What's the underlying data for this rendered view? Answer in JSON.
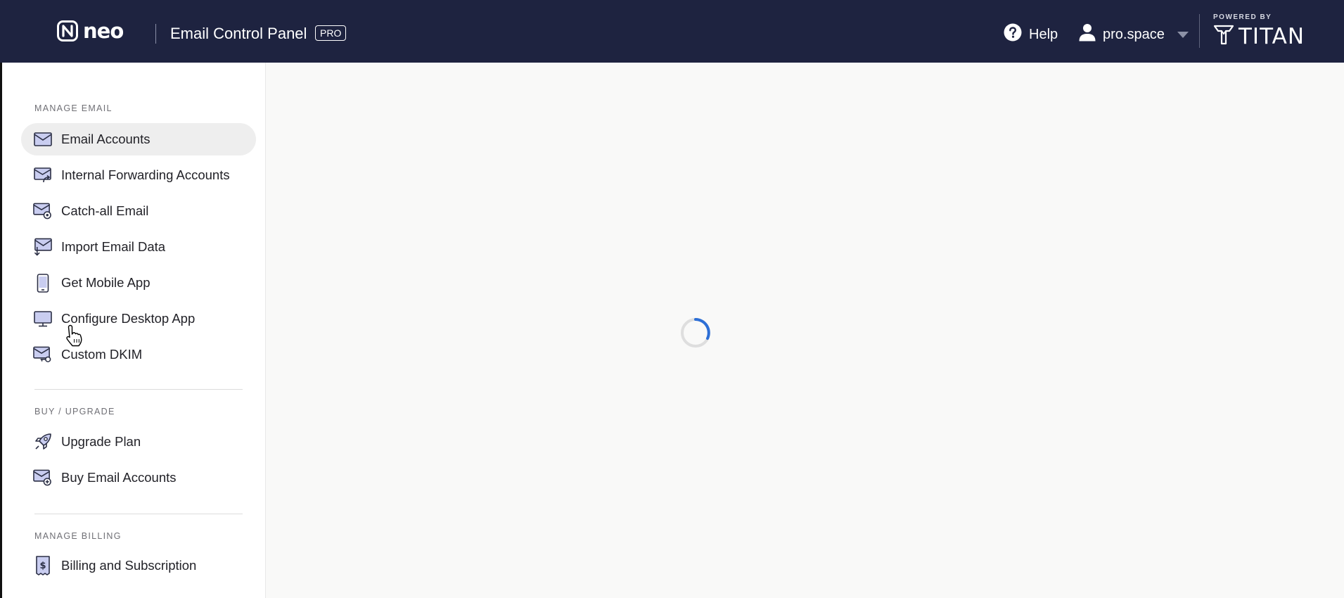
{
  "header": {
    "logo_text": "neo",
    "title": "Email Control Panel",
    "badge": "PRO",
    "help_label": "Help",
    "help_icon": "question-circle-icon",
    "user_label": "pro.space",
    "user_icon": "user-icon",
    "powered_by": "POWERED BY",
    "titan_text": "TITAN",
    "bg_color": "#1e2340"
  },
  "sidebar": {
    "sections": [
      {
        "title": "MANAGE EMAIL",
        "items": [
          {
            "label": "Email Accounts",
            "icon": "envelope-icon",
            "active": true
          },
          {
            "label": "Internal Forwarding Accounts",
            "icon": "forward-envelope-icon",
            "active": false
          },
          {
            "label": "Catch-all Email",
            "icon": "envelope-gear-icon",
            "active": false
          },
          {
            "label": "Import Email Data",
            "icon": "import-envelope-icon",
            "active": false
          },
          {
            "label": "Get Mobile App",
            "icon": "mobile-icon",
            "active": false
          },
          {
            "label": "Configure Desktop App",
            "icon": "desktop-icon",
            "active": false
          },
          {
            "label": "Custom DKIM",
            "icon": "envelope-key-icon",
            "active": false
          }
        ]
      },
      {
        "title": "BUY / UPGRADE",
        "items": [
          {
            "label": "Upgrade Plan",
            "icon": "rocket-icon",
            "active": false
          },
          {
            "label": "Buy Email Accounts",
            "icon": "envelope-plus-icon",
            "active": false
          }
        ]
      },
      {
        "title": "MANAGE BILLING",
        "items": [
          {
            "label": "Billing and Subscription",
            "icon": "billing-receipt-icon",
            "active": false
          }
        ]
      }
    ]
  },
  "main": {
    "state": "loading",
    "spinner_color": "#2d6fd6"
  },
  "colors": {
    "accent": "#2d6fd6",
    "icon_tint": "#c9cdf0",
    "icon_stroke": "#2b2f45"
  }
}
